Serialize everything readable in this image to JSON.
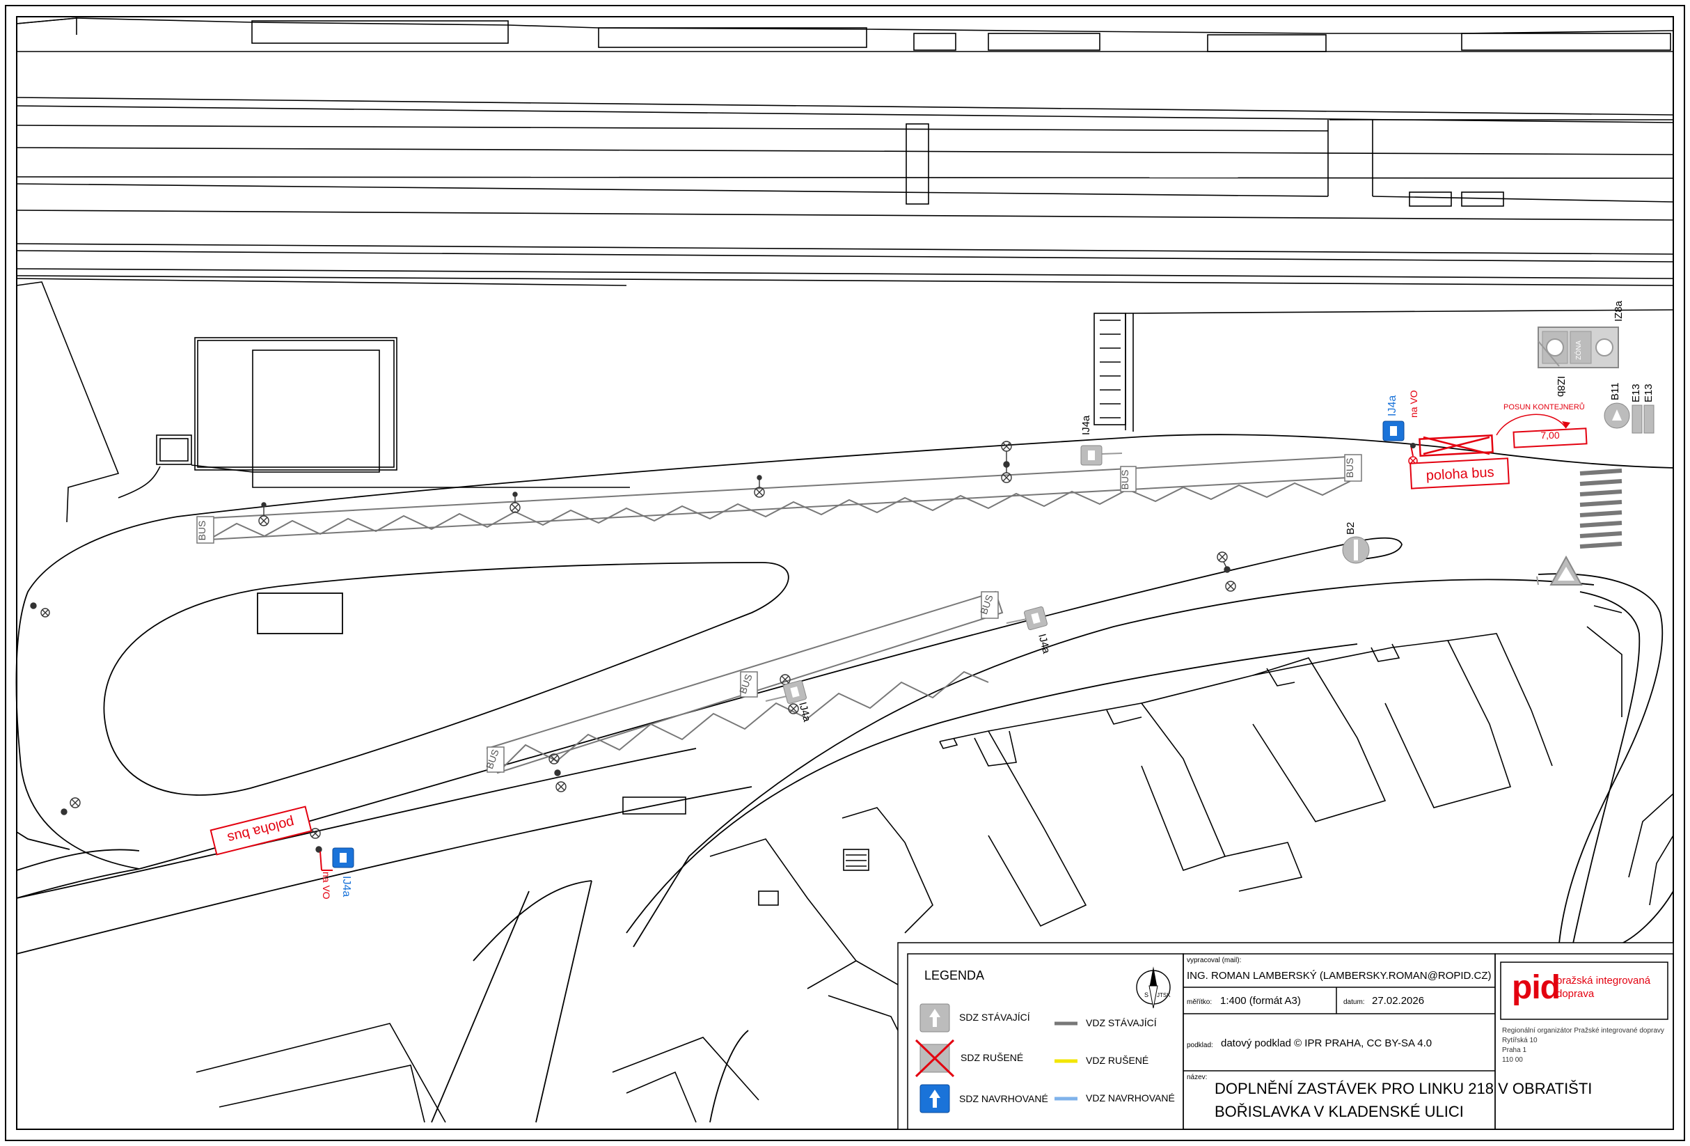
{
  "map": {
    "labels": {
      "bus": "BUS",
      "ij4a": "IJ4a",
      "b2": "B2",
      "b11": "B11",
      "e13": "E13",
      "iz8a": "IZ8a",
      "iz8b": "IZ8b",
      "na_vo": "na VO",
      "poloha_bus": "poloha bus",
      "posun_kontejneru": "POSUN KONTEJNERŮ",
      "dimension": "7,00",
      "zona": "ZÓNA"
    }
  },
  "legend": {
    "title": "LEGENDA",
    "items": {
      "sdz_stavajici": "SDZ STÁVAJÍCÍ",
      "sdz_rusene": "SDZ RUŠENÉ",
      "sdz_navrhovane": "SDZ NAVRHOVANÉ",
      "vdz_stavajici": "VDZ STÁVAJÍCÍ",
      "vdz_rusene": "VDZ RUŠENÉ",
      "vdz_navrhovane": "VDZ NAVRHOVANÉ"
    },
    "colors": {
      "vdz_stavajici": "#777777",
      "vdz_rusene": "#f2e600",
      "vdz_navrhovane": "#7fb2ea",
      "proposed": "#1a73d9",
      "removed": "#e3000f"
    },
    "north": {
      "s": "S",
      "jtsk": "JTSK"
    }
  },
  "title_block": {
    "author_label": "vypracoval (mail):",
    "author": "ING. ROMAN LAMBERSKÝ (LAMBERSKY.ROMAN@ROPID.CZ)",
    "scale_label": "měřítko:",
    "scale": "1:400 (formát A3)",
    "date_label": "datum:",
    "date": "27.02.2026",
    "source_label": "podklad:",
    "source": "datový podklad © IPR PRAHA, CC BY-SA 4.0",
    "name_label": "název:",
    "name_line1": "DOPLNĚNÍ ZASTÁVEK PRO LINKU 218 V OBRATIŠTI",
    "name_line2": "BOŘISLAVKA V KLADENSKÉ ULICI",
    "logo_text": "pid",
    "logo_sub1": "pražská integrovaná",
    "logo_sub2": "doprava",
    "org1": "Regionální organizátor Pražské integrované dopravy",
    "org2": "Rytířská 10",
    "org3": "Praha 1",
    "org4": "110 00"
  }
}
